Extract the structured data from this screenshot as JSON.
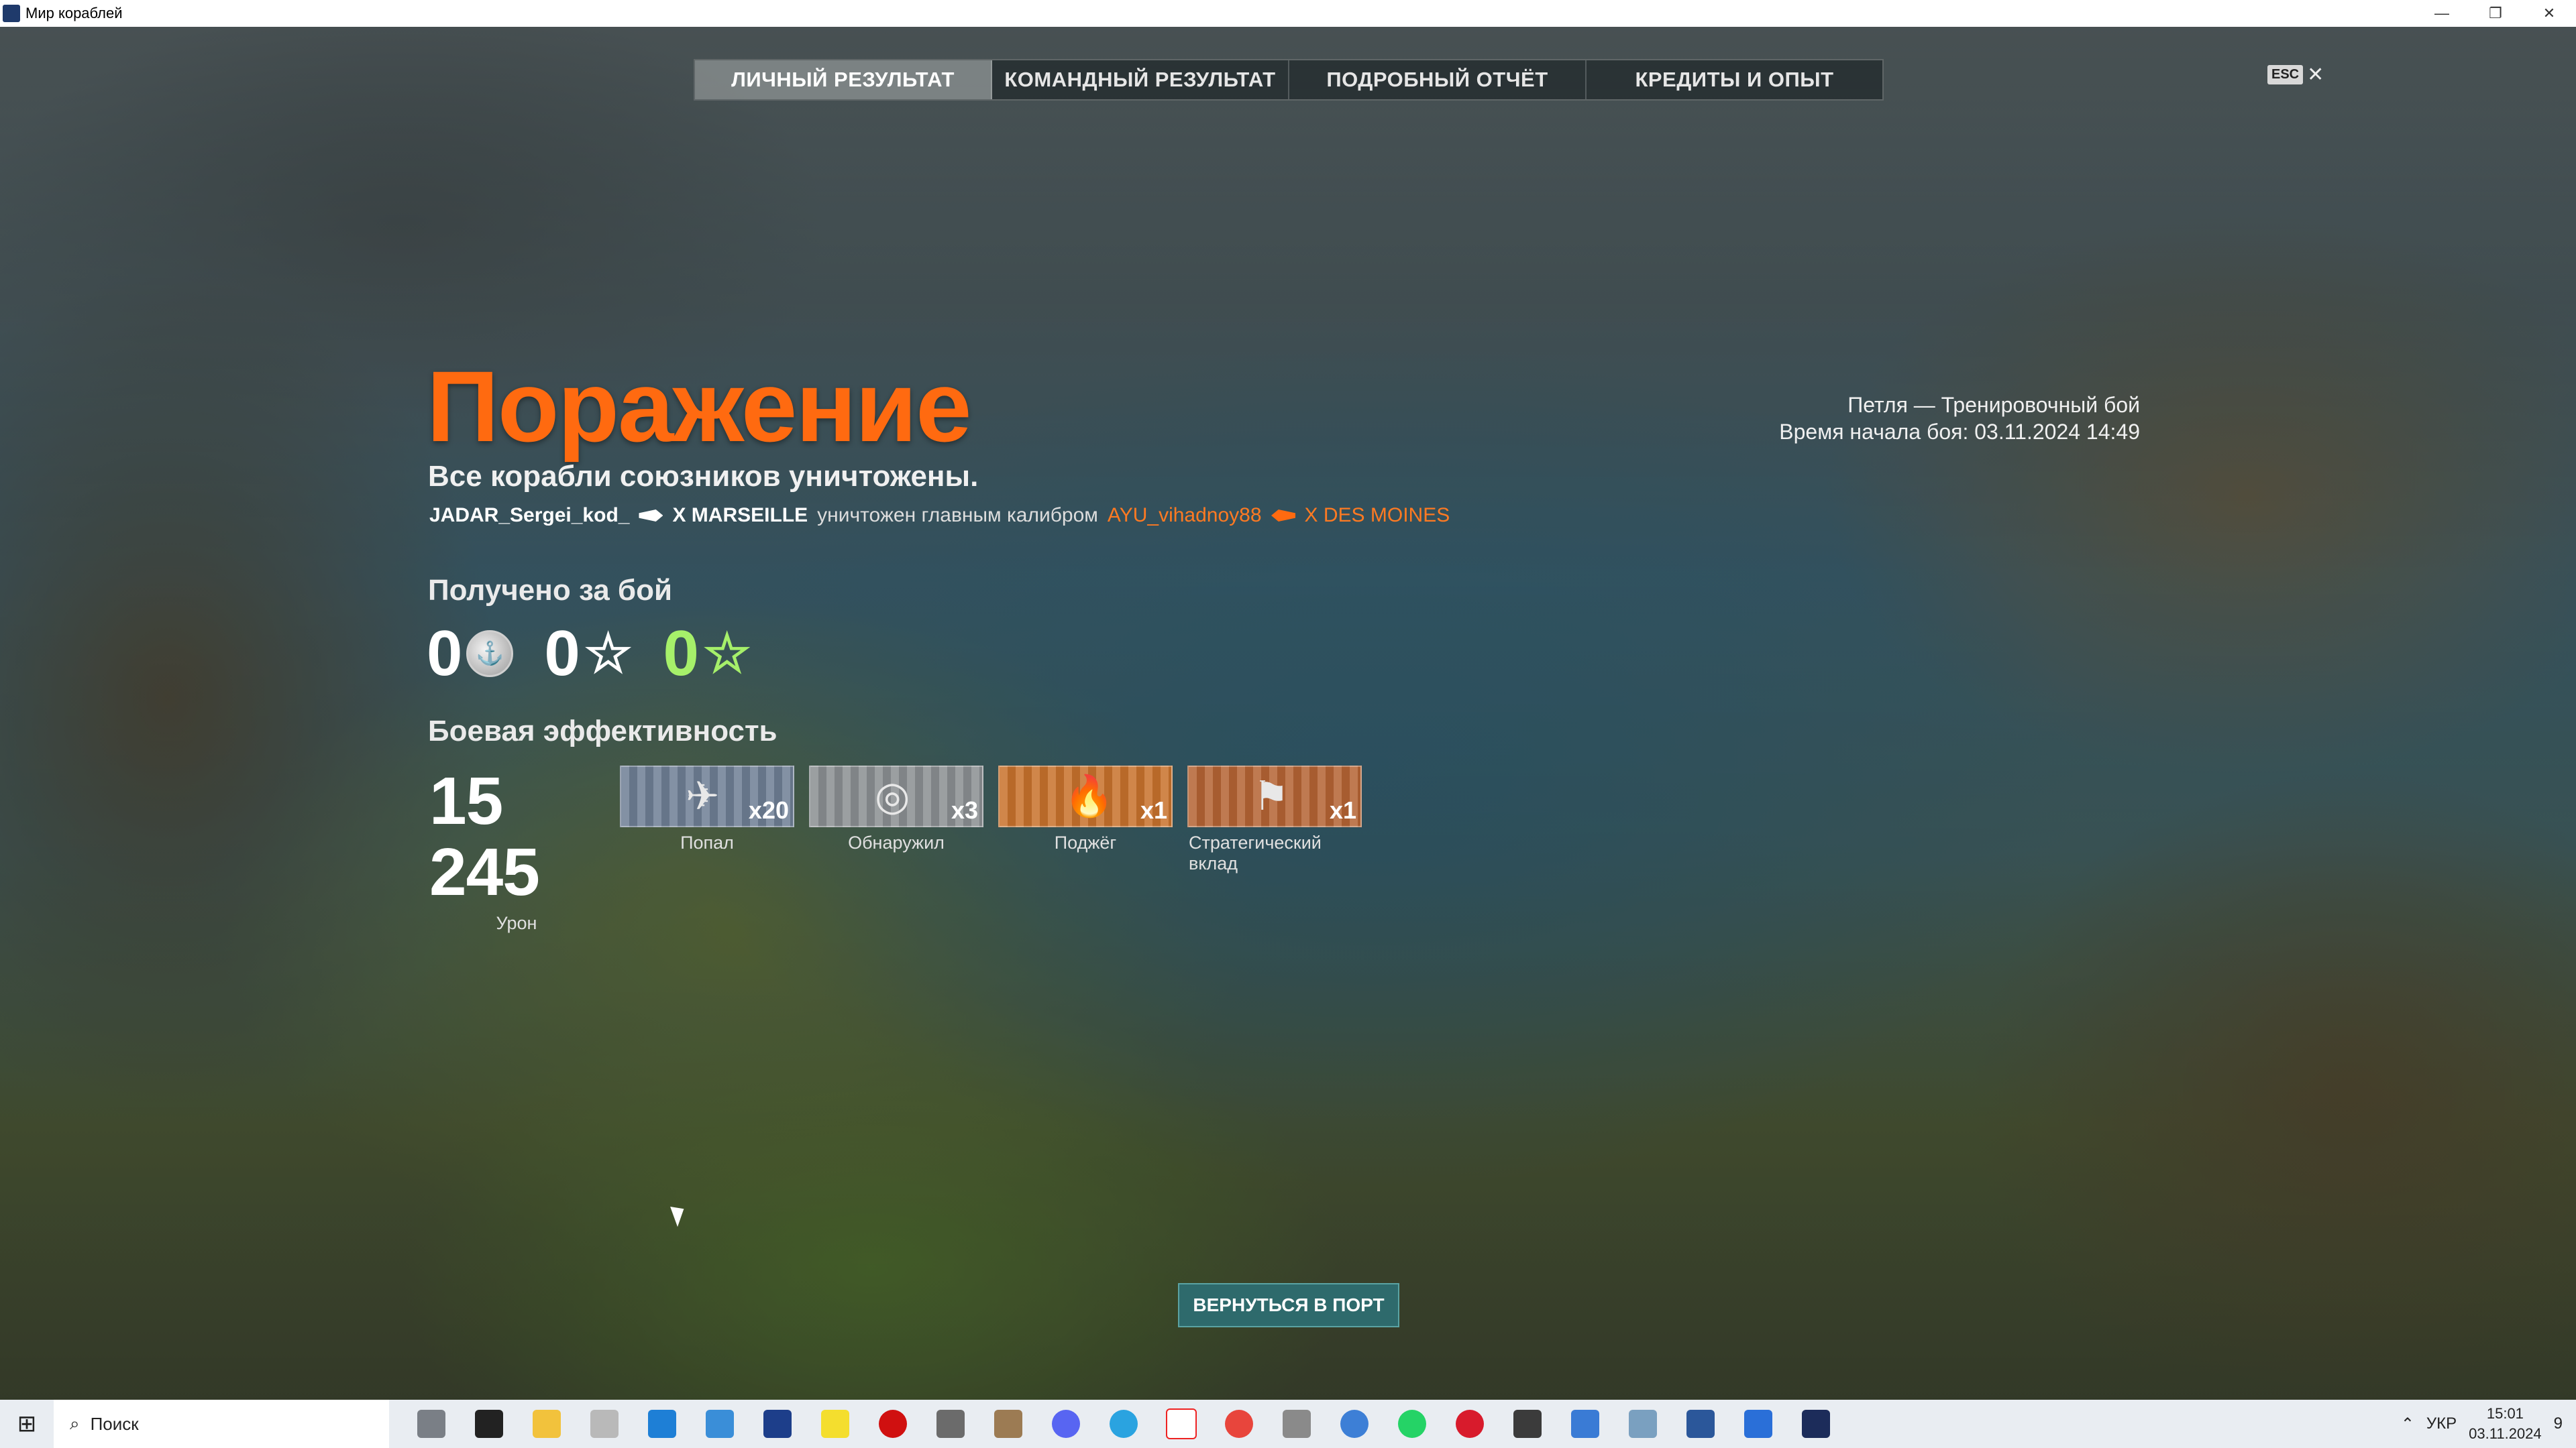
{
  "window": {
    "title": "Мир кораблей",
    "controls": [
      "—",
      "❐",
      "✕"
    ]
  },
  "tabs": [
    {
      "label": "ЛИЧНЫЙ РЕЗУЛЬТАТ",
      "active": true
    },
    {
      "label": "КОМАНДНЫЙ РЕЗУЛЬТАТ",
      "active": false
    },
    {
      "label": "ПОДРОБНЫЙ ОТЧЁТ",
      "active": false
    },
    {
      "label": "КРЕДИТЫ И ОПЫТ",
      "active": false
    }
  ],
  "esc": {
    "key": "ESC",
    "close": "✕"
  },
  "result": {
    "title": "Поражение",
    "subtitle": "Все корабли союзников уничтожены.",
    "kill": {
      "player": "JADAR_Sergei_kod_",
      "ship": "X MARSEILLE",
      "desc": "уничтожен главным калибром",
      "enemy_player": "AYU_vihadnoy88",
      "enemy_ship": "X DES MOINES"
    }
  },
  "battle_info": {
    "map_mode": "Петля — Тренировочный бой",
    "start_time": "Время начала боя: 03.11.2024 14:49"
  },
  "earned": {
    "title": "Получено за бой",
    "credits": "0",
    "xp": "0",
    "free_xp": "0",
    "star": "☆",
    "colors": {
      "free_xp": "#a6f06a"
    }
  },
  "efficiency": {
    "title": "Боевая эффективность",
    "damage": {
      "value": "15 245",
      "label": "Урон"
    },
    "ribbons": [
      {
        "label": "Попал",
        "count": "x20",
        "icon": "✈",
        "icon_name": "hit-icon",
        "color": "blue"
      },
      {
        "label": "Обнаружил",
        "count": "x3",
        "icon": "◎",
        "icon_name": "spotted-icon",
        "color": "grey"
      },
      {
        "label": "Поджёг",
        "count": "x1",
        "icon": "🔥",
        "icon_name": "fire-icon",
        "color": "orange"
      },
      {
        "label": "Стратегический вклад",
        "count": "x1",
        "icon": "⚑",
        "icon_name": "flag-icon",
        "color": "rust"
      }
    ]
  },
  "return_button": {
    "label": "ВЕРНУТЬСЯ В ПОРТ"
  },
  "taskbar": {
    "search_placeholder": "Поиск",
    "language": "УКР",
    "time": "15:01",
    "date": "03.11.2024",
    "notifications": "9"
  }
}
